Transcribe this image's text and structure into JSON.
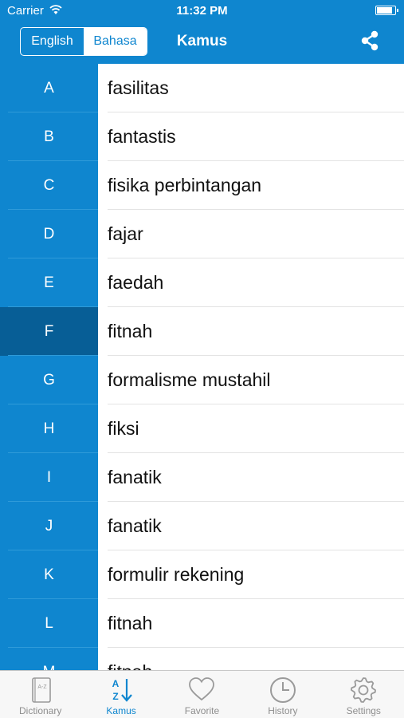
{
  "status_bar": {
    "carrier": "Carrier",
    "time": "11:32 PM",
    "battery_level": 0.9
  },
  "nav": {
    "segment": {
      "options": [
        "English",
        "Bahasa"
      ],
      "selected": "Bahasa"
    },
    "title": "Kamus",
    "share_icon": "share-icon"
  },
  "index": {
    "letters": [
      "A",
      "B",
      "C",
      "D",
      "E",
      "F",
      "G",
      "H",
      "I",
      "J",
      "K",
      "L",
      "M"
    ],
    "selected": "F"
  },
  "words": [
    "fasilitas",
    "fantastis",
    "fisika perbintangan",
    "fajar",
    "faedah",
    "fitnah",
    "formalisme mustahil",
    "fiksi",
    "fanatik",
    "fanatik",
    "formulir rekening",
    "fitnah",
    "fitnah"
  ],
  "tabs": [
    {
      "label": "Dictionary",
      "icon": "dictionary-icon"
    },
    {
      "label": "Kamus",
      "icon": "sort-az-icon"
    },
    {
      "label": "Favorite",
      "icon": "heart-icon"
    },
    {
      "label": "History",
      "icon": "clock-icon"
    },
    {
      "label": "Settings",
      "icon": "gear-icon"
    }
  ],
  "active_tab": "Kamus",
  "colors": {
    "accent": "#0f86cf",
    "index_selected": "#075e96",
    "tab_inactive": "#8e8e8e"
  }
}
